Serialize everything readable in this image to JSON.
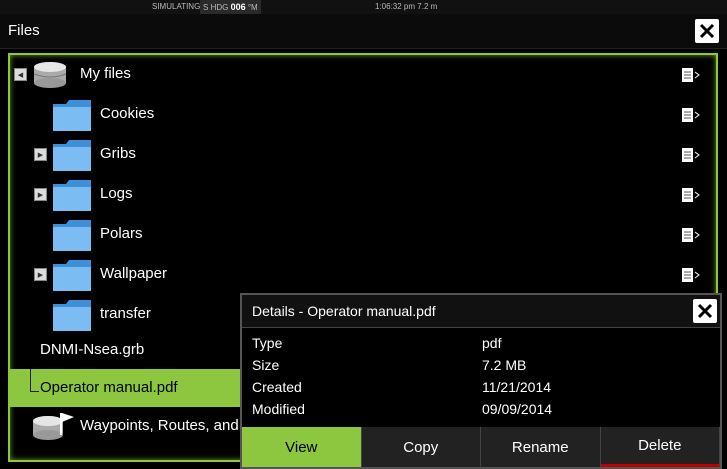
{
  "status": {
    "simulating": "SIMULATING...",
    "hdg_s": "S",
    "hdg_label": "HDG",
    "hdg_value": "006",
    "hdg_unit": "°M",
    "time": "1:06:32 pm",
    "distance": "7.2 m"
  },
  "window": {
    "title": "Files"
  },
  "tree": {
    "root": "My files",
    "items": [
      "Cookies",
      "Gribs",
      "Logs",
      "Polars",
      "Wallpaper",
      "transfer"
    ],
    "file1": "DNMI-Nsea.grb",
    "selected_file": "Operator manual.pdf",
    "bottom": "Waypoints, Routes, and T"
  },
  "details": {
    "title": "Details - Operator manual.pdf",
    "rows": [
      {
        "key": "Type",
        "value": "pdf"
      },
      {
        "key": "Size",
        "value": "7.2 MB"
      },
      {
        "key": "Created",
        "value": "11/21/2014"
      },
      {
        "key": "Modified",
        "value": "09/09/2014"
      }
    ],
    "buttons": [
      "View",
      "Copy",
      "Rename",
      "Delete"
    ]
  },
  "colors": {
    "accent": "#8dc63f",
    "folder": "#5aa7e8",
    "delete_bar": "#b00000"
  },
  "icons": [
    "close-icon",
    "database-icon",
    "folder-icon",
    "document-menu-icon",
    "expander-icon",
    "waypoints-db-icon"
  ]
}
